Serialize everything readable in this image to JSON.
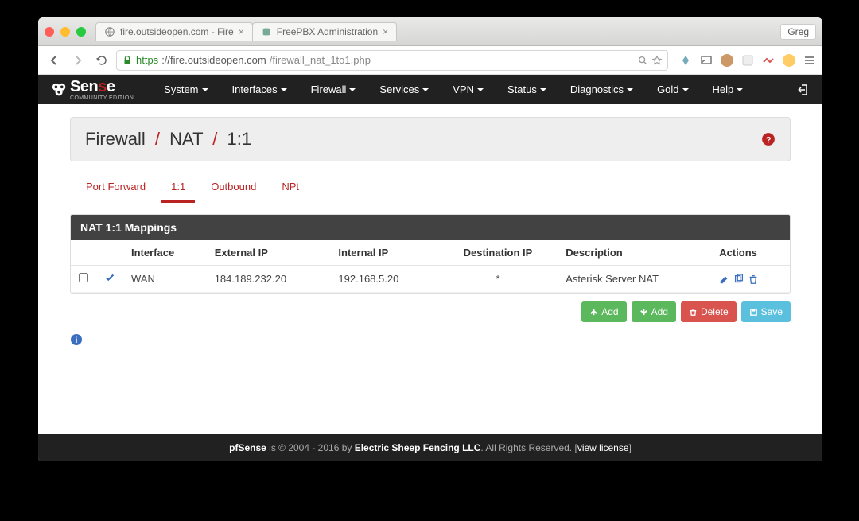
{
  "browser": {
    "tabs": [
      {
        "title": "fire.outsideopen.com - Fire",
        "icon": "globe"
      },
      {
        "title": "FreePBX Administration",
        "icon": "pbx"
      }
    ],
    "profile": "Greg",
    "url_scheme": "https",
    "url_host": "://fire.outsideopen.com",
    "url_path": "/firewall_nat_1to1.php"
  },
  "nav": {
    "brand_a": "Sen",
    "brand_b": "s",
    "brand_c": "e",
    "edition": "COMMUNITY EDITION",
    "items": [
      "System",
      "Interfaces",
      "Firewall",
      "Services",
      "VPN",
      "Status",
      "Diagnostics",
      "Gold",
      "Help"
    ]
  },
  "page": {
    "crumb1": "Firewall",
    "crumb2": "NAT",
    "crumb3": "1:1",
    "tabs": [
      "Port Forward",
      "1:1",
      "Outbound",
      "NPt"
    ],
    "active_tab": "1:1"
  },
  "panel": {
    "title": "NAT 1:1 Mappings",
    "cols": [
      "",
      "",
      "Interface",
      "External IP",
      "Internal IP",
      "Destination IP",
      "Description",
      "Actions"
    ],
    "row": {
      "interface": "WAN",
      "external_ip": "184.189.232.20",
      "internal_ip": "192.168.5.20",
      "dest_ip": "*",
      "description": "Asterisk Server NAT"
    }
  },
  "buttons": {
    "add": "Add",
    "delete": "Delete",
    "save": "Save"
  },
  "footer": {
    "brand": "pfSense",
    "mid": " is © 2004 - 2016 by ",
    "company": "Electric Sheep Fencing LLC",
    "rights": ". All Rights Reserved. [",
    "link": "view license",
    "end": "]"
  }
}
